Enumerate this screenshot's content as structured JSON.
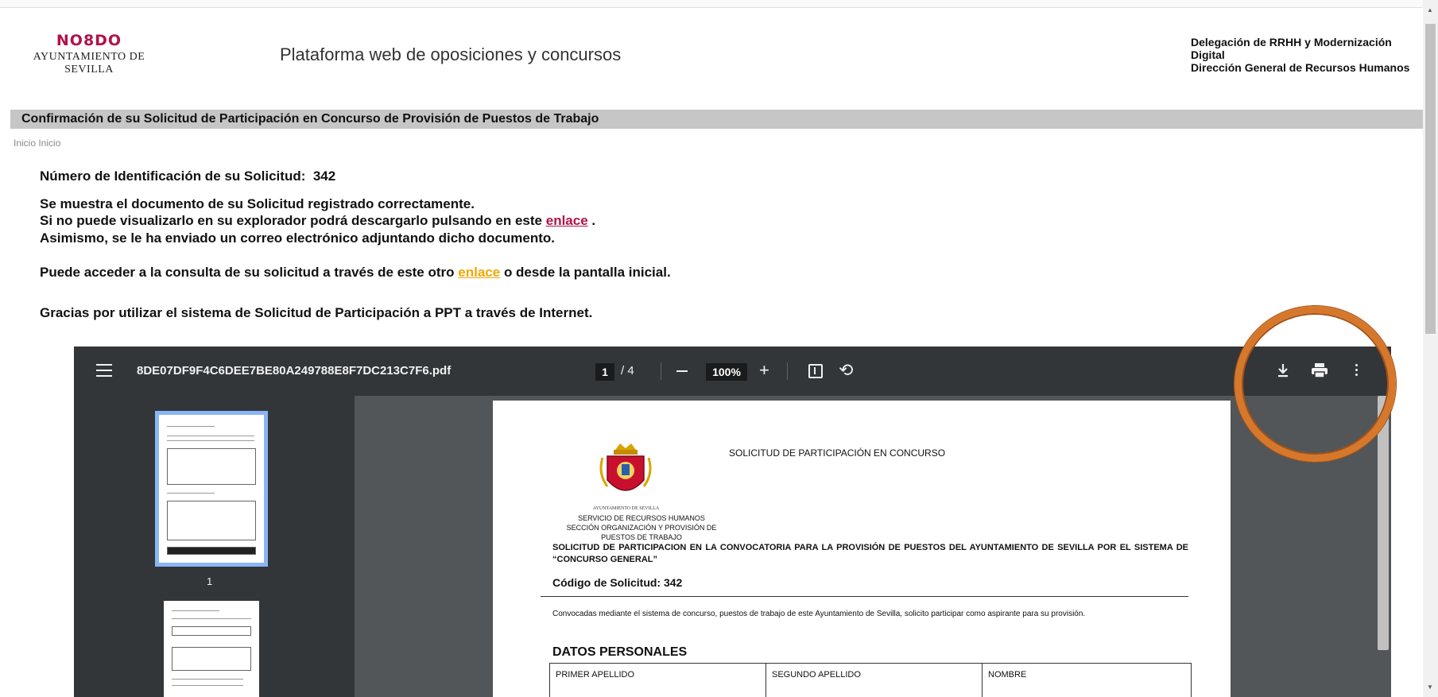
{
  "header": {
    "logo_top": "NO8DO",
    "logo_bottom": "AYUNTAMIENTO DE SEVILLA",
    "platform_title": "Plataforma web de oposiciones y concursos",
    "delegacion_line1": "Delegación de RRHH y Modernización Digital",
    "delegacion_line2": "Dirección General de Recursos Humanos"
  },
  "titlebar": {
    "title": "Confirmación de su Solicitud de Participación en Concurso de Provisión de Puestos de Trabajo"
  },
  "breadcrumb": {
    "text": "Inicio Inicio"
  },
  "content": {
    "id_label": "Número de Identificación de su Solicitud:",
    "id_value": "342",
    "line1": "Se muestra el documento de su Solicitud registrado correctamente.",
    "line2_before": "Si no puede visualizarlo en su explorador podrá descargarlo pulsando en este",
    "line2_link": "enlace",
    "line2_after": ".",
    "line3": "Asimismo, se le ha enviado un correo electrónico adjuntando dicho documento.",
    "line4_before": "Puede acceder a la consulta de su solicitud a través de este otro",
    "line4_link": "enlace",
    "line4_after": "o desde la pantalla inicial.",
    "line5": "Gracias por utilizar el sistema de Solicitud de Participación a PPT a través de Internet."
  },
  "viewer": {
    "filename": "8DE07DF9F4C6DEE7BE80A249788E8F7DC213C7F6.pdf",
    "current_page": "1",
    "page_total": "/ 4",
    "zoom": "100%",
    "thumb1_label": "1",
    "icons": {
      "menu": "menu-icon",
      "zoom_out": "minus-icon",
      "zoom_in": "plus-icon",
      "fit": "fit-page-icon",
      "rotate": "rotate-icon",
      "download": "download-icon",
      "print": "print-icon",
      "more": "more-vert-icon"
    }
  },
  "pdf_page": {
    "solicitud_title": "SOLICITUD DE PARTICIPACIÓN EN CONCURSO",
    "crest_caption": "AYUNTAMIENTO DE SEVILLA",
    "service_line1": "SERVICIO DE RECURSOS HUMANOS",
    "service_line2": "SECCIÓN ORGANIZACIÓN Y PROVISIÓN DE",
    "service_line3": "PUESTOS DE TRABAJO",
    "heading": "SOLICITUD DE PARTICIPACION EN LA CONVOCATORIA PARA LA PROVISIÓN DE PUESTOS DEL AYUNTAMIENTO DE SEVILLA POR EL SISTEMA DE “CONCURSO GENERAL”",
    "code": "Código de Solicitud: 342",
    "text": "Convocadas mediante el sistema de concurso, puestos de trabajo de este Ayuntamiento de Sevilla, solicito participar como aspirante para su provisión.",
    "datos_title": "DATOS PERSONALES",
    "col1": "PRIMER APELLIDO",
    "col2": "SEGUNDO APELLIDO",
    "col3": "NOMBRE"
  },
  "colors": {
    "brand_red": "#b0124a",
    "link_yellow": "#f0a800",
    "toolbar": "#323639",
    "highlight_ring": "#d6782c"
  }
}
